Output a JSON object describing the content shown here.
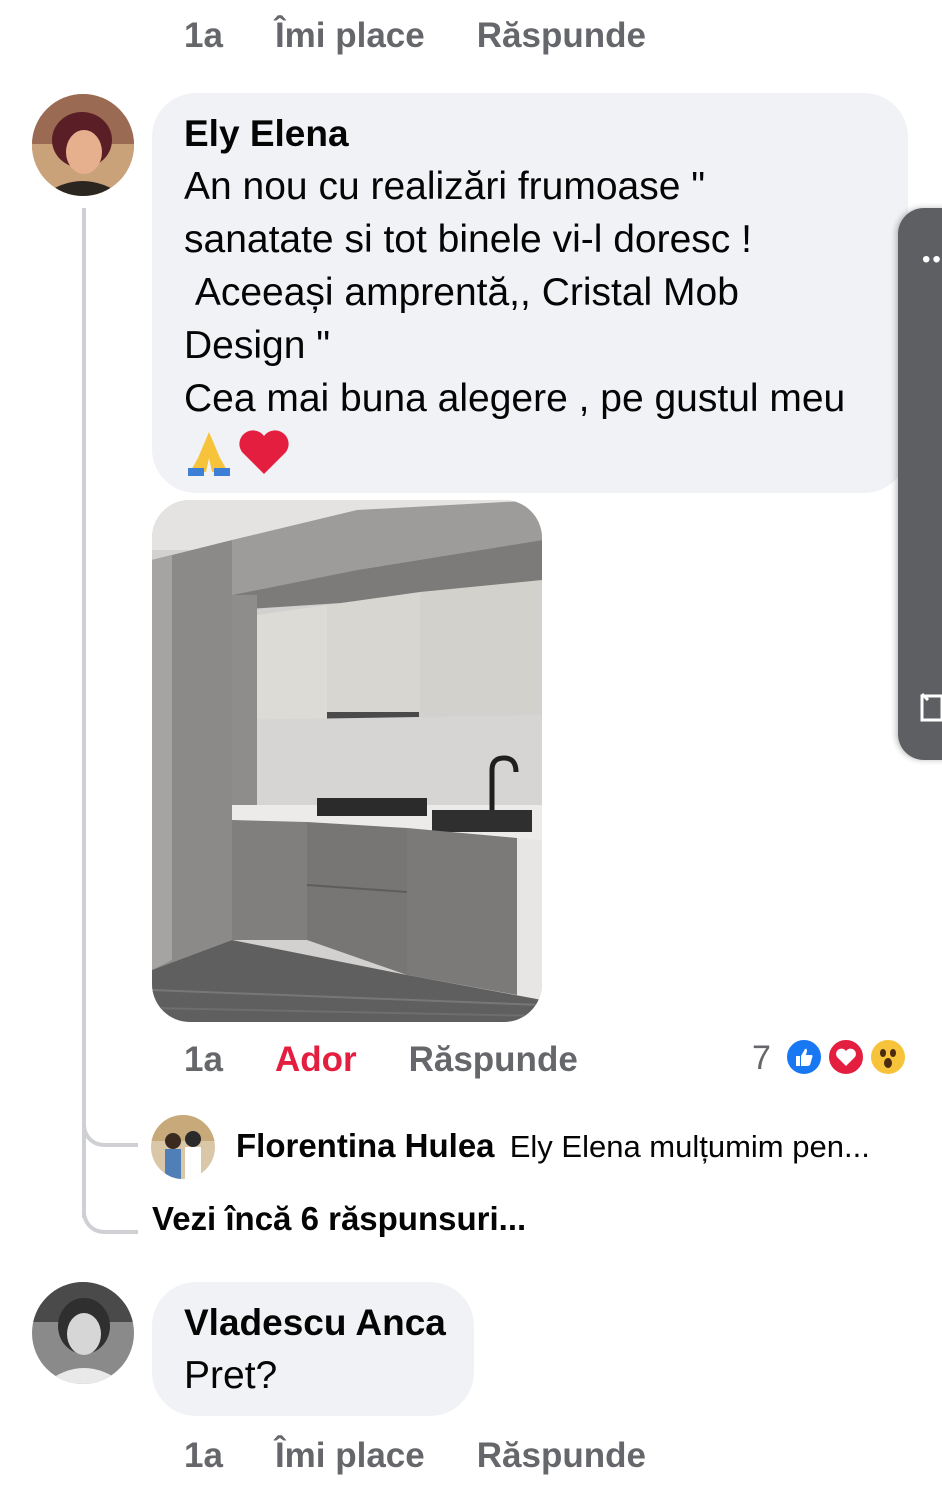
{
  "top_actions": {
    "time": "1a",
    "like": "Îmi place",
    "reply": "Răspunde"
  },
  "comment1": {
    "author": "Ely Elena",
    "text": "An nou cu realizări frumoase \"\nsanatate si tot binele vi-l doresc !\n Aceeași amprentă,, Cristal Mob\nDesign \"\nCea mai buna alegere , pe gustul meu",
    "emoji": "🙏❤️",
    "photo_alt": "kitchen-photo",
    "time": "1a",
    "like": "Ador",
    "reply": "Răspunde",
    "reaction_count": "7",
    "reactions": [
      "like-reaction-icon",
      "love-reaction-icon",
      "wow-reaction-icon"
    ]
  },
  "reply1": {
    "author": "Florentina Hulea",
    "text": "Ely Elena mulțumim pen..."
  },
  "more_replies": "Vezi încă 6 răspunsuri...",
  "comment2": {
    "author": "Vladescu Anca",
    "text": "Pret?",
    "time": "1a",
    "like": "Îmi place",
    "reply": "Răspunde"
  },
  "colors": {
    "bubble": "#f0f2f5",
    "meta": "#65676b",
    "love": "#e41e3f",
    "like_blue": "#1877f2"
  }
}
